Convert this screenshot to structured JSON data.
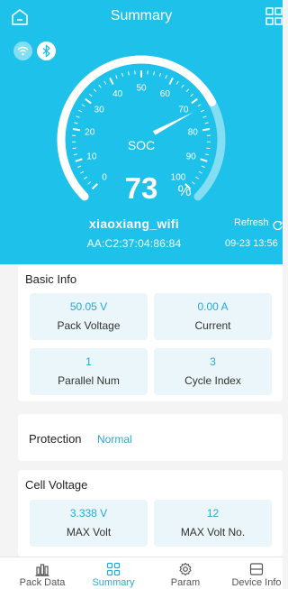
{
  "header": {
    "title": "Summary"
  },
  "gauge": {
    "label": "SOC",
    "value": "73",
    "unit": "%",
    "soc_fraction": 0.73,
    "ticks": [
      "0",
      "10",
      "20",
      "30",
      "40",
      "50",
      "60",
      "70",
      "80",
      "90",
      "100"
    ]
  },
  "device": {
    "name": "xiaoxiang_wifi",
    "mac": "AA:C2:37:04:86:84",
    "refresh_label": "Refresh",
    "time": "09-23 13:56"
  },
  "basic_info": {
    "title": "Basic Info",
    "items": [
      {
        "value": "50.05 V",
        "label": "Pack Voltage"
      },
      {
        "value": "0.00 A",
        "label": "Current"
      },
      {
        "value": "1",
        "label": "Parallel Num"
      },
      {
        "value": "3",
        "label": "Cycle Index"
      }
    ]
  },
  "protection": {
    "label": "Protection",
    "status": "Normal"
  },
  "cell_voltage": {
    "title": "Cell Voltage",
    "items": [
      {
        "value": "3.338 V",
        "label": "MAX Volt"
      },
      {
        "value": "12",
        "label": "MAX Volt No."
      }
    ]
  },
  "tabs": [
    {
      "label": "Pack Data",
      "icon": "bar-chart-icon"
    },
    {
      "label": "Summary",
      "icon": "grid-icon",
      "active": true
    },
    {
      "label": "Param",
      "icon": "gear-icon"
    },
    {
      "label": "Device Info",
      "icon": "device-icon"
    }
  ],
  "colors": {
    "header_bg": "#1ec1ea",
    "accent": "#2aa8d6",
    "tile_bg": "#eaf6f9"
  }
}
